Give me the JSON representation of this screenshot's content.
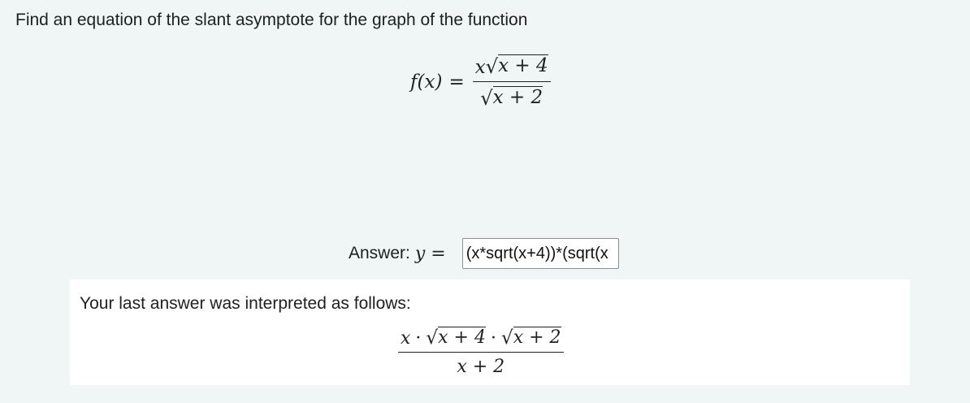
{
  "question": {
    "text": "Find an equation of the slant asymptote for the graph of the function"
  },
  "function_display": {
    "lhs": "f(x)",
    "equals": "=",
    "numerator_x": "x",
    "numerator_radicand": "x + 4",
    "denominator_radicand": "x + 2"
  },
  "answer": {
    "label": "Answer:",
    "variable": "y =",
    "input_value": "(x*sqrt(x+4))*(sqrt(x"
  },
  "feedback": {
    "text": "Your last answer was interpreted as follows:",
    "numerator_x": "x",
    "dot1": "·",
    "radicand1": "x + 4",
    "dot2": "·",
    "radicand2": "x + 2",
    "denominator": "x + 2"
  }
}
